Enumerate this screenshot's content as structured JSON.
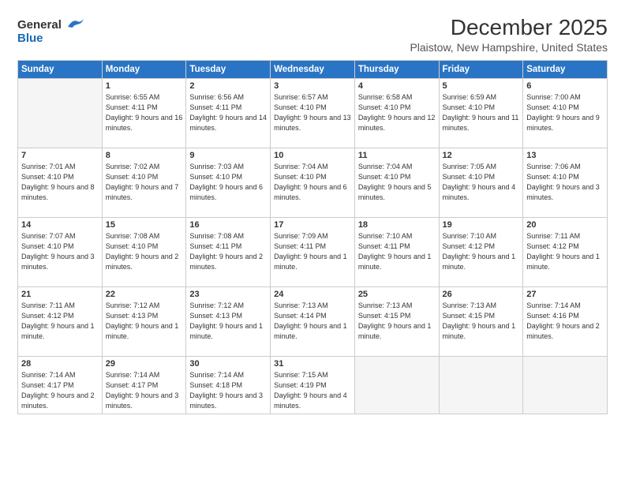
{
  "header": {
    "logo_general": "General",
    "logo_blue": "Blue",
    "title": "December 2025",
    "location": "Plaistow, New Hampshire, United States"
  },
  "weekdays": [
    "Sunday",
    "Monday",
    "Tuesday",
    "Wednesday",
    "Thursday",
    "Friday",
    "Saturday"
  ],
  "weeks": [
    [
      {
        "day": "",
        "sunrise": "",
        "sunset": "",
        "daylight": ""
      },
      {
        "day": "1",
        "sunrise": "Sunrise: 6:55 AM",
        "sunset": "Sunset: 4:11 PM",
        "daylight": "Daylight: 9 hours and 16 minutes."
      },
      {
        "day": "2",
        "sunrise": "Sunrise: 6:56 AM",
        "sunset": "Sunset: 4:11 PM",
        "daylight": "Daylight: 9 hours and 14 minutes."
      },
      {
        "day": "3",
        "sunrise": "Sunrise: 6:57 AM",
        "sunset": "Sunset: 4:10 PM",
        "daylight": "Daylight: 9 hours and 13 minutes."
      },
      {
        "day": "4",
        "sunrise": "Sunrise: 6:58 AM",
        "sunset": "Sunset: 4:10 PM",
        "daylight": "Daylight: 9 hours and 12 minutes."
      },
      {
        "day": "5",
        "sunrise": "Sunrise: 6:59 AM",
        "sunset": "Sunset: 4:10 PM",
        "daylight": "Daylight: 9 hours and 11 minutes."
      },
      {
        "day": "6",
        "sunrise": "Sunrise: 7:00 AM",
        "sunset": "Sunset: 4:10 PM",
        "daylight": "Daylight: 9 hours and 9 minutes."
      }
    ],
    [
      {
        "day": "7",
        "sunrise": "Sunrise: 7:01 AM",
        "sunset": "Sunset: 4:10 PM",
        "daylight": "Daylight: 9 hours and 8 minutes."
      },
      {
        "day": "8",
        "sunrise": "Sunrise: 7:02 AM",
        "sunset": "Sunset: 4:10 PM",
        "daylight": "Daylight: 9 hours and 7 minutes."
      },
      {
        "day": "9",
        "sunrise": "Sunrise: 7:03 AM",
        "sunset": "Sunset: 4:10 PM",
        "daylight": "Daylight: 9 hours and 6 minutes."
      },
      {
        "day": "10",
        "sunrise": "Sunrise: 7:04 AM",
        "sunset": "Sunset: 4:10 PM",
        "daylight": "Daylight: 9 hours and 6 minutes."
      },
      {
        "day": "11",
        "sunrise": "Sunrise: 7:04 AM",
        "sunset": "Sunset: 4:10 PM",
        "daylight": "Daylight: 9 hours and 5 minutes."
      },
      {
        "day": "12",
        "sunrise": "Sunrise: 7:05 AM",
        "sunset": "Sunset: 4:10 PM",
        "daylight": "Daylight: 9 hours and 4 minutes."
      },
      {
        "day": "13",
        "sunrise": "Sunrise: 7:06 AM",
        "sunset": "Sunset: 4:10 PM",
        "daylight": "Daylight: 9 hours and 3 minutes."
      }
    ],
    [
      {
        "day": "14",
        "sunrise": "Sunrise: 7:07 AM",
        "sunset": "Sunset: 4:10 PM",
        "daylight": "Daylight: 9 hours and 3 minutes."
      },
      {
        "day": "15",
        "sunrise": "Sunrise: 7:08 AM",
        "sunset": "Sunset: 4:10 PM",
        "daylight": "Daylight: 9 hours and 2 minutes."
      },
      {
        "day": "16",
        "sunrise": "Sunrise: 7:08 AM",
        "sunset": "Sunset: 4:11 PM",
        "daylight": "Daylight: 9 hours and 2 minutes."
      },
      {
        "day": "17",
        "sunrise": "Sunrise: 7:09 AM",
        "sunset": "Sunset: 4:11 PM",
        "daylight": "Daylight: 9 hours and 1 minute."
      },
      {
        "day": "18",
        "sunrise": "Sunrise: 7:10 AM",
        "sunset": "Sunset: 4:11 PM",
        "daylight": "Daylight: 9 hours and 1 minute."
      },
      {
        "day": "19",
        "sunrise": "Sunrise: 7:10 AM",
        "sunset": "Sunset: 4:12 PM",
        "daylight": "Daylight: 9 hours and 1 minute."
      },
      {
        "day": "20",
        "sunrise": "Sunrise: 7:11 AM",
        "sunset": "Sunset: 4:12 PM",
        "daylight": "Daylight: 9 hours and 1 minute."
      }
    ],
    [
      {
        "day": "21",
        "sunrise": "Sunrise: 7:11 AM",
        "sunset": "Sunset: 4:12 PM",
        "daylight": "Daylight: 9 hours and 1 minute."
      },
      {
        "day": "22",
        "sunrise": "Sunrise: 7:12 AM",
        "sunset": "Sunset: 4:13 PM",
        "daylight": "Daylight: 9 hours and 1 minute."
      },
      {
        "day": "23",
        "sunrise": "Sunrise: 7:12 AM",
        "sunset": "Sunset: 4:13 PM",
        "daylight": "Daylight: 9 hours and 1 minute."
      },
      {
        "day": "24",
        "sunrise": "Sunrise: 7:13 AM",
        "sunset": "Sunset: 4:14 PM",
        "daylight": "Daylight: 9 hours and 1 minute."
      },
      {
        "day": "25",
        "sunrise": "Sunrise: 7:13 AM",
        "sunset": "Sunset: 4:15 PM",
        "daylight": "Daylight: 9 hours and 1 minute."
      },
      {
        "day": "26",
        "sunrise": "Sunrise: 7:13 AM",
        "sunset": "Sunset: 4:15 PM",
        "daylight": "Daylight: 9 hours and 1 minute."
      },
      {
        "day": "27",
        "sunrise": "Sunrise: 7:14 AM",
        "sunset": "Sunset: 4:16 PM",
        "daylight": "Daylight: 9 hours and 2 minutes."
      }
    ],
    [
      {
        "day": "28",
        "sunrise": "Sunrise: 7:14 AM",
        "sunset": "Sunset: 4:17 PM",
        "daylight": "Daylight: 9 hours and 2 minutes."
      },
      {
        "day": "29",
        "sunrise": "Sunrise: 7:14 AM",
        "sunset": "Sunset: 4:17 PM",
        "daylight": "Daylight: 9 hours and 3 minutes."
      },
      {
        "day": "30",
        "sunrise": "Sunrise: 7:14 AM",
        "sunset": "Sunset: 4:18 PM",
        "daylight": "Daylight: 9 hours and 3 minutes."
      },
      {
        "day": "31",
        "sunrise": "Sunrise: 7:15 AM",
        "sunset": "Sunset: 4:19 PM",
        "daylight": "Daylight: 9 hours and 4 minutes."
      },
      {
        "day": "",
        "sunrise": "",
        "sunset": "",
        "daylight": ""
      },
      {
        "day": "",
        "sunrise": "",
        "sunset": "",
        "daylight": ""
      },
      {
        "day": "",
        "sunrise": "",
        "sunset": "",
        "daylight": ""
      }
    ]
  ]
}
